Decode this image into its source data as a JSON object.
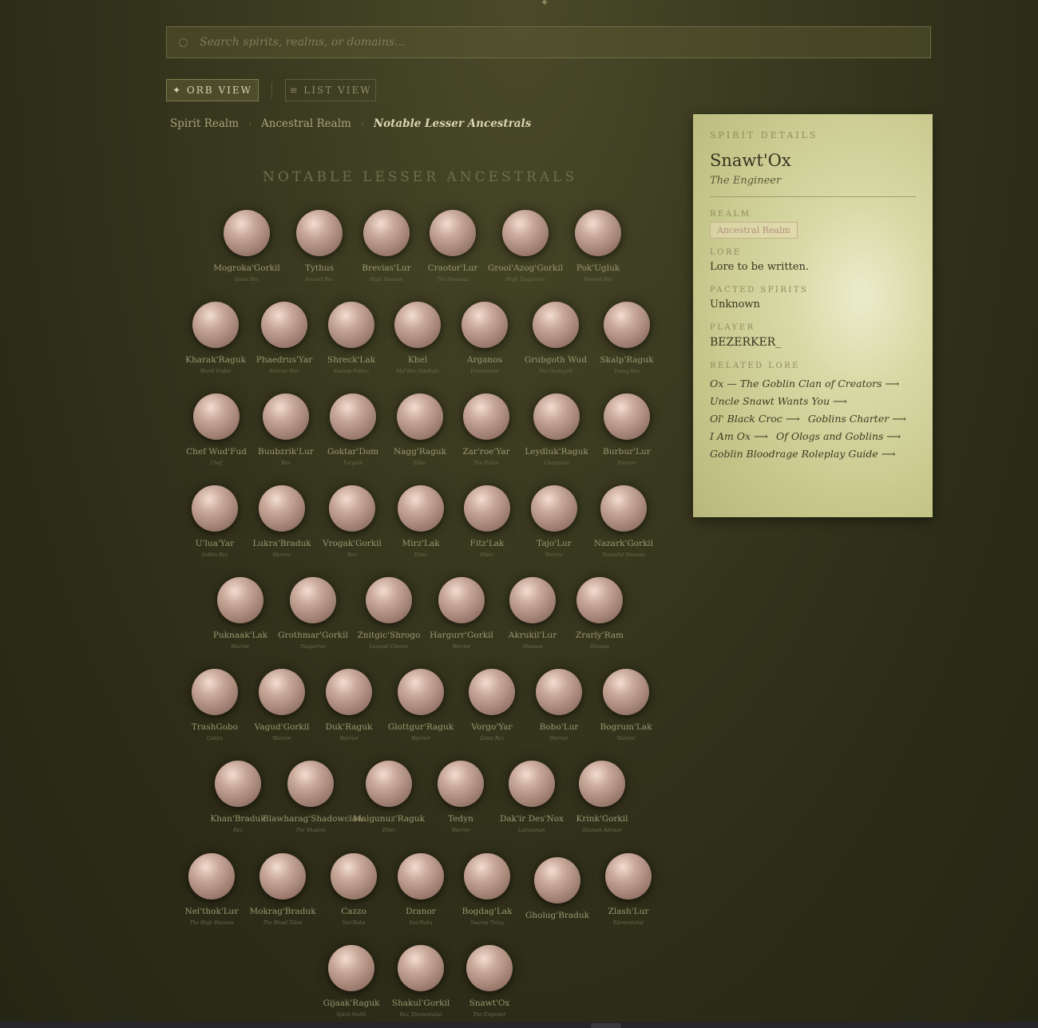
{
  "search": {
    "placeholder": "Search spirits, realms, or domains..."
  },
  "views": {
    "orb": "✦ ORB VIEW",
    "list": "≡ LIST VIEW"
  },
  "breadcrumb": [
    "Spirit Realm",
    "Ancestral Realm",
    "Notable Lesser Ancestrals"
  ],
  "section_title": "NOTABLE LESSER ANCESTRALS",
  "spirits": [
    {
      "name": "Mogroka'Gorkil",
      "title": "Great Rex"
    },
    {
      "name": "Tythus",
      "title": "Second Rex"
    },
    {
      "name": "Brevias'Lur",
      "title": "High Shaman"
    },
    {
      "name": "Craotor'Lur",
      "title": "The Dominus"
    },
    {
      "name": "Grool'Azog'Gorkil",
      "title": "High Tsagavrun"
    },
    {
      "name": "Pok'Ugluk",
      "title": "Horned Rex"
    },
    {
      "name": "Kharak'Raguk",
      "title": "World Ender"
    },
    {
      "name": "Phaedrus'Yar",
      "title": "Forever Rex"
    },
    {
      "name": "Shreck'Lak",
      "title": "Swamp-Father"
    },
    {
      "name": "Khel",
      "title": "Mal'Rex chieftain"
    },
    {
      "name": "Arganos",
      "title": "Entertainer"
    },
    {
      "name": "Grubgoth Wud",
      "title": "The Grubgoth"
    },
    {
      "name": "Skalp'Raguk",
      "title": "Young Rex"
    },
    {
      "name": "Chef Wud'Fud",
      "title": "Chef"
    },
    {
      "name": "Buubzrik'Lur",
      "title": "Rex"
    },
    {
      "name": "Goktar'Dom",
      "title": "Turgoth"
    },
    {
      "name": "Nagg'Raguk",
      "title": "Elder"
    },
    {
      "name": "Zar'roe'Yar",
      "title": "The Fallen"
    },
    {
      "name": "Leydluk'Raguk",
      "title": "Champion"
    },
    {
      "name": "Burbur'Lur",
      "title": "Forever"
    },
    {
      "name": "U'lua'Yar",
      "title": "Goblin Rex"
    },
    {
      "name": "Lukra'Braduk",
      "title": "Warrior"
    },
    {
      "name": "Vrogak'Gorkil",
      "title": "Rex"
    },
    {
      "name": "Mirz'Lak",
      "title": "Elder"
    },
    {
      "name": "Fitz'Lak",
      "title": "Elder"
    },
    {
      "name": "Tajo'Lur",
      "title": "Warrior"
    },
    {
      "name": "Nazark'Gorkil",
      "title": "Powerful Shaman"
    },
    {
      "name": "Puknaak'Lak",
      "title": "Warrior"
    },
    {
      "name": "Grothmar'Gorkil",
      "title": "Tsagavrun"
    },
    {
      "name": "Znitgic'Shrogo",
      "title": "Lauradi Charon"
    },
    {
      "name": "Hargurr'Gorkil",
      "title": "Warrior"
    },
    {
      "name": "Akrukil'Lur",
      "title": "Shaman"
    },
    {
      "name": "Zrarly'Ram",
      "title": "Shaman"
    },
    {
      "name": "TrashGobo",
      "title": "Goblin"
    },
    {
      "name": "Vagud'Gorkil",
      "title": "Warrior"
    },
    {
      "name": "Duk'Raguk",
      "title": "Warrior"
    },
    {
      "name": "Glottgur'Raguk",
      "title": "Warrior"
    },
    {
      "name": "Vorgo'Yar",
      "title": "Great Rex"
    },
    {
      "name": "Bobo'Lur",
      "title": "Warrior"
    },
    {
      "name": "Bogrum'Lak",
      "title": "Warrior"
    },
    {
      "name": "Khan'Braduk",
      "title": "Rex"
    },
    {
      "name": "Blawharag'Shadowclaw",
      "title": "The Shadow"
    },
    {
      "name": "Malgunuz'Raguk",
      "title": "Elder"
    },
    {
      "name": "Tedyn",
      "title": "Warrior"
    },
    {
      "name": "Dak'ir Des'Nox",
      "title": "Lutzauman"
    },
    {
      "name": "Krink'Gorkil",
      "title": "Shaman Advisor"
    },
    {
      "name": "Nel'thok'Lur",
      "title": "The High Shaman"
    },
    {
      "name": "Mokrag'Braduk",
      "title": "The Blood Talon"
    },
    {
      "name": "Cazzo",
      "title": "Sun'Raha"
    },
    {
      "name": "Dranor",
      "title": "Sun'Raha"
    },
    {
      "name": "Bogdag'Lak",
      "title": "Swamp Thing"
    },
    {
      "name": "Gholug'Braduk",
      "title": ""
    },
    {
      "name": "Zlash'Lur",
      "title": "Elementalist"
    },
    {
      "name": "Gijaak'Raguk",
      "title": "Spirit Smith"
    },
    {
      "name": "Shakul'Gorkil",
      "title": "Rex, Elementalist"
    },
    {
      "name": "Snawt'Ox",
      "title": "The Engineer"
    }
  ],
  "details": {
    "header": "SPIRIT DETAILS",
    "name": "Snawt'Ox",
    "title": "The Engineer",
    "realm_label": "REALM",
    "realm": "Ancestral Realm",
    "lore_label": "LORE",
    "lore": "Lore to be written.",
    "pacted_label": "PACTED SPIRITS",
    "pacted": "Unknown",
    "player_label": "PLAYER",
    "player": "BEZERKER_",
    "related_label": "RELATED LORE",
    "related": [
      "Ox — The Goblin Clan of Creators ⟶",
      "Uncle Snawt Wants You ⟶",
      "Ol' Black Croc ⟶",
      "Goblins Charter ⟶",
      "I Am Ox ⟶",
      "Of Ologs and Goblins ⟶",
      "Goblin Bloodrage Roleplay Guide ⟶"
    ]
  }
}
